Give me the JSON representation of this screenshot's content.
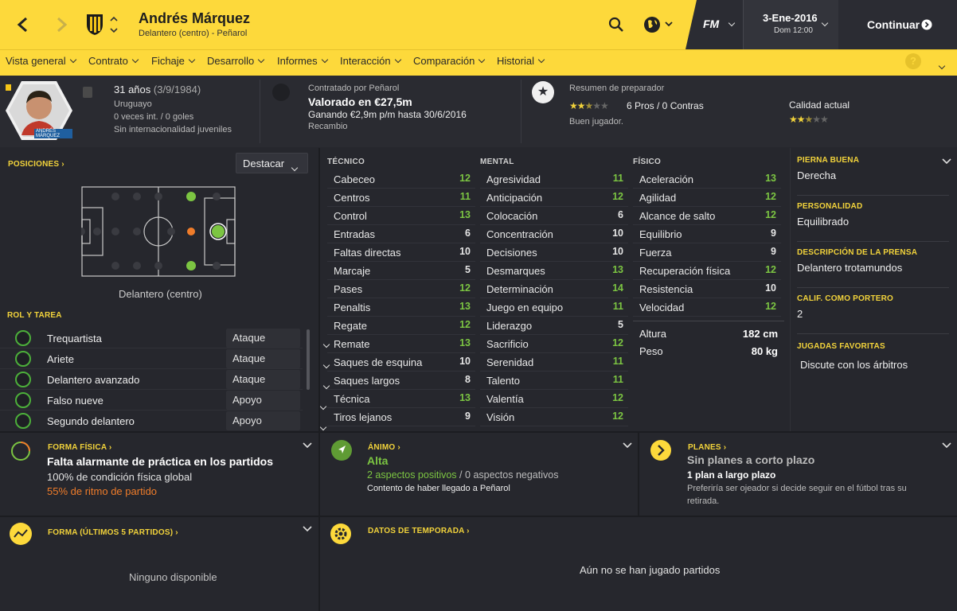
{
  "header": {
    "player_name": "Andrés Márquez",
    "subtitle": "Delantero (centro) - Peñarol",
    "date": "3-Ene-2016",
    "time": "Dom 12:00",
    "continue_label": "Continuar",
    "fm_logo": "FM"
  },
  "icons": {
    "back": "chevron-left-icon",
    "forward": "chevron-right-icon",
    "club": "club-crest-icon",
    "search": "search-icon",
    "globe": "globe-icon",
    "help": "help-icon"
  },
  "menu": [
    "Vista general",
    "Contrato",
    "Fichaje",
    "Desarrollo",
    "Informes",
    "Interacción",
    "Comparación",
    "Historial"
  ],
  "help_label": "?",
  "info": {
    "age": "31 años",
    "dob": "(3/9/1984)",
    "nationality": "Uruguayo",
    "caps": "0 veces int. / 0 goles",
    "youth": "Sin internacionalidad juveniles",
    "contract_by": "Contratado por Peñarol",
    "value": "Valorado en €27,5m",
    "wage": "Ganando €2,9m p/m hasta 30/6/2016",
    "status": "Recambio",
    "coach_title": "Resumen de preparador",
    "pros_cons": "6 Pros / 0 Contras",
    "coach_note": "Buen jugador.",
    "current_ability": "Calidad actual",
    "coach_stars": 2.5,
    "ability_stars": 2.5,
    "card_name": "ANDRÉS MÁRQUEZ"
  },
  "positions": {
    "title": "POSICIONES",
    "highlight_label": "Destacar",
    "position_label": "Delantero (centro)"
  },
  "roles": {
    "title": "ROL Y TAREA",
    "items": [
      {
        "name": "Trequartista",
        "duty": "Ataque"
      },
      {
        "name": "Ariete",
        "duty": "Ataque"
      },
      {
        "name": "Delantero avanzado",
        "duty": "Ataque"
      },
      {
        "name": "Falso nueve",
        "duty": "Apoyo"
      },
      {
        "name": "Segundo delantero",
        "duty": "Apoyo"
      }
    ]
  },
  "attributes": {
    "technical_title": "TÉCNICO",
    "mental_title": "MENTAL",
    "physical_title": "FÍSICO",
    "technical": [
      [
        "Cabeceo",
        "12"
      ],
      [
        "Centros",
        "11"
      ],
      [
        "Control",
        "13"
      ],
      [
        "Entradas",
        "6"
      ],
      [
        "Faltas directas",
        "10"
      ],
      [
        "Marcaje",
        "5"
      ],
      [
        "Pases",
        "12"
      ],
      [
        "Penaltis",
        "13"
      ],
      [
        "Regate",
        "12"
      ],
      [
        "Remate",
        "13"
      ],
      [
        "Saques de esquina",
        "10"
      ],
      [
        "Saques largos",
        "8"
      ],
      [
        "Técnica",
        "13"
      ],
      [
        "Tiros lejanos",
        "9"
      ]
    ],
    "mental": [
      [
        "Agresividad",
        "11"
      ],
      [
        "Anticipación",
        "12"
      ],
      [
        "Colocación",
        "6"
      ],
      [
        "Concentración",
        "10"
      ],
      [
        "Decisiones",
        "10"
      ],
      [
        "Desmarques",
        "13"
      ],
      [
        "Determinación",
        "14"
      ],
      [
        "Juego en equipo",
        "11"
      ],
      [
        "Liderazgo",
        "5"
      ],
      [
        "Sacrificio",
        "12"
      ],
      [
        "Serenidad",
        "11"
      ],
      [
        "Talento",
        "11"
      ],
      [
        "Valentía",
        "12"
      ],
      [
        "Visión",
        "12"
      ]
    ],
    "physical": [
      [
        "Aceleración",
        "13"
      ],
      [
        "Agilidad",
        "12"
      ],
      [
        "Alcance de salto",
        "12"
      ],
      [
        "Equilibrio",
        "9"
      ],
      [
        "Fuerza",
        "9"
      ],
      [
        "Recuperación física",
        "12"
      ],
      [
        "Resistencia",
        "10"
      ],
      [
        "Velocidad",
        "12"
      ]
    ],
    "height_label": "Altura",
    "height": "182 cm",
    "weight_label": "Peso",
    "weight": "80 kg"
  },
  "side": [
    {
      "title": "PIERNA BUENA",
      "value": "Derecha"
    },
    {
      "title": "PERSONALIDAD",
      "value": "Equilibrado"
    },
    {
      "title": "DESCRIPCIÓN DE LA PRENSA",
      "value": "Delantero trotamundos"
    },
    {
      "title": "CALIF. COMO PORTERO",
      "value": "2"
    },
    {
      "title": "JUGADAS FAVORITAS",
      "value": "Discute con los árbitros"
    }
  ],
  "fitness": {
    "title": "FORMA FÍSICA",
    "headline": "Falta alarmante de práctica en los partidos",
    "condition": "100% de condición física global",
    "match_sharpness": "55% de ritmo de partido"
  },
  "morale": {
    "title": "ÁNIMO",
    "level": "Alta",
    "positives": "2 aspectos positivos",
    "negatives": "0 aspectos negativos",
    "sep": "/",
    "note": "Contento de haber llegado a Peñarol"
  },
  "plans": {
    "title": "PLANES",
    "headline": "Sin planes a corto plazo",
    "long_term": "1 plan a largo plazo",
    "detail1": "Preferiría ser ojeador si decide seguir en el fútbol tras su",
    "detail2": "retirada."
  },
  "form": {
    "title": "FORMA (ÚLTIMOS 5 PARTIDOS)",
    "empty": "Ninguno disponible"
  },
  "season": {
    "title": "DATOS DE TEMPORADA",
    "empty": "Aún no se han jugado partidos"
  },
  "colors": {
    "accent": "#fdd93b",
    "green": "#7cc542",
    "orange": "#ef7c2a"
  }
}
